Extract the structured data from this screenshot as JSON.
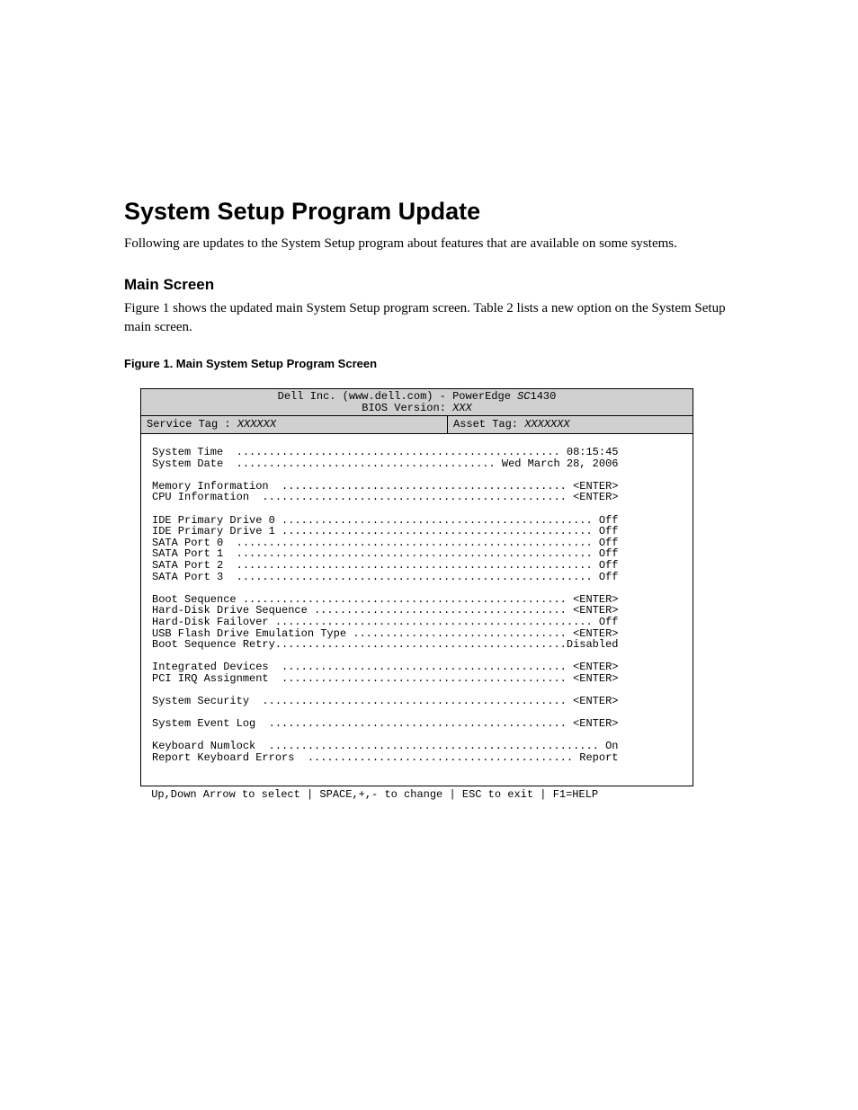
{
  "heading": "System Setup Program Update",
  "intro": "Following are updates to the System Setup program about features that are available on some systems.",
  "subheading": "Main Screen",
  "desc": "Figure 1 shows the updated main System Setup program screen. Table 2 lists a new option on the System Setup main screen.",
  "figcap": "Figure 1.    Main System Setup Program Screen",
  "bios": {
    "title_prefix": "Dell Inc. (www.dell.com) - PowerEdge ",
    "title_model_italic": "SC",
    "title_model_rest": "1430",
    "bios_version_label": "BIOS Version: ",
    "bios_version_value": "XXX",
    "service_tag_label": "Service Tag : ",
    "service_tag_value": "XXXXXX",
    "asset_tag_label": "Asset Tag: ",
    "asset_tag_value": "XXXXXXX",
    "lines": [
      {
        "label": "System Time  ",
        "value": " 08:15:45"
      },
      {
        "label": "System Date  ",
        "value": " Wed March 28, 2006"
      },
      {
        "blank": true
      },
      {
        "label": "Memory Information  ",
        "value": " <ENTER>"
      },
      {
        "label": "CPU Information  ",
        "value": " <ENTER>"
      },
      {
        "blank": true
      },
      {
        "label": "IDE Primary Drive 0 ",
        "value": " Off"
      },
      {
        "label": "IDE Primary Drive 1 ",
        "value": " Off"
      },
      {
        "label": "SATA Port 0  ",
        "value": " Off"
      },
      {
        "label": "SATA Port 1  ",
        "value": " Off"
      },
      {
        "label": "SATA Port 2  ",
        "value": " Off"
      },
      {
        "label": "SATA Port 3  ",
        "value": " Off"
      },
      {
        "blank": true
      },
      {
        "label": "Boot Sequence ",
        "value": " <ENTER>"
      },
      {
        "label": "Hard-Disk Drive Sequence ",
        "value": " <ENTER>"
      },
      {
        "label": "Hard-Disk Failover ",
        "value": " Off"
      },
      {
        "label": "USB Flash Drive Emulation Type ",
        "value": " <ENTER>"
      },
      {
        "label": "Boot Sequence Retry",
        "value": "Disabled"
      },
      {
        "blank": true
      },
      {
        "label": "Integrated Devices  ",
        "value": " <ENTER>"
      },
      {
        "label": "PCI IRQ Assignment  ",
        "value": " <ENTER>"
      },
      {
        "blank": true
      },
      {
        "label": "System Security  ",
        "value": " <ENTER>"
      },
      {
        "blank": true
      },
      {
        "label": "System Event Log  ",
        "value": " <ENTER>"
      },
      {
        "blank": true
      },
      {
        "label": "Keyboard Numlock  ",
        "value": " On"
      },
      {
        "label": "Report Keyboard Errors  ",
        "value": " Report"
      }
    ],
    "line_width": 72,
    "footer": {
      "seg1": " Up,Down Arrow to select ",
      "seg2": " SPACE,+,- to change ",
      "seg3": " ESC to exit ",
      "seg4": " F1=HELP"
    }
  }
}
